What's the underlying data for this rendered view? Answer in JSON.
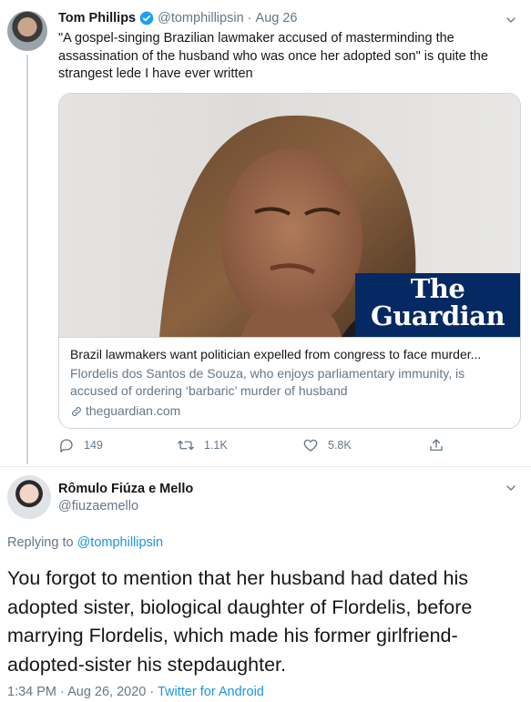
{
  "tweet1": {
    "name": "Tom Phillips",
    "handle": "@tomphillipsin",
    "date": "Aug 26",
    "text": "\"A gospel-singing Brazilian lawmaker accused of masterminding the assassination of the husband who was once her adopted son\" is quite the strangest lede I have ever written",
    "card": {
      "logo_line1": "The",
      "logo_line2": "Guardian",
      "title": "Brazil lawmakers want politician expelled from congress to face murder...",
      "description": "Flordelis dos Santos de Souza, who enjoys parliamentary immunity, is accused of ordering ‘barbaric’ murder of husband",
      "domain": "theguardian.com"
    },
    "replies": "149",
    "retweets": "1.1K",
    "likes": "5.8K"
  },
  "tweet2": {
    "name": "Rômulo Fiúza e Mello",
    "handle": "@fiuzaemello",
    "replying_prefix": "Replying to",
    "replying_to": "@tomphillipsin",
    "text": "You forgot to mention that her husband had dated his adopted sister, biological daughter of Flordelis, before marrying Flordelis, which made his former girlfriend-adopted-sister his stepdaughter.",
    "timestamp": "1:34 PM · Aug 26, 2020",
    "source": "Twitter for Android"
  },
  "colors": {
    "link": "#1b95e0",
    "muted": "#657786",
    "guardian": "#052962"
  }
}
